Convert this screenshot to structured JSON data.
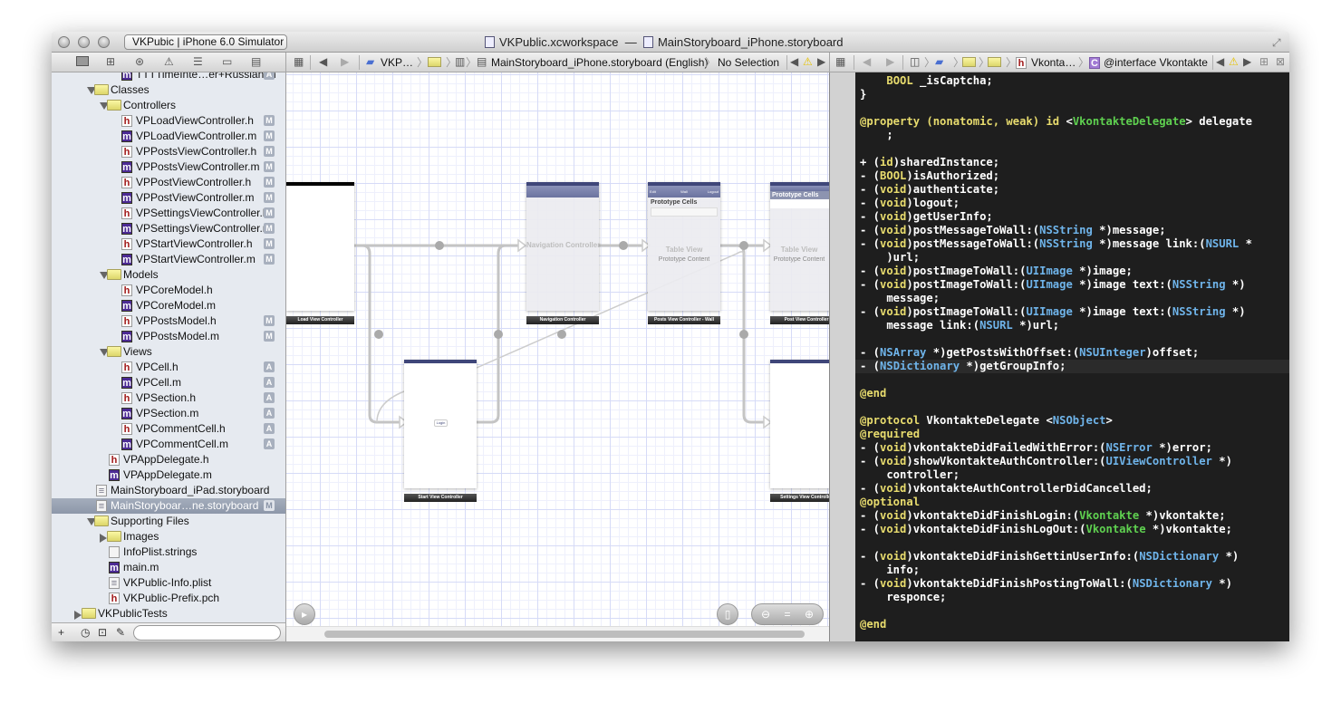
{
  "window": {
    "title_workspace": "VKPublic.xcworkspace",
    "title_sep": "—",
    "title_file": "MainStoryboard_iPhone.storyboard",
    "scheme": "VKPubic | iPhone 6.0 Simulator"
  },
  "navigator_tabs": [
    {
      "icon": "folder-icon"
    },
    {
      "icon": "hierarchy-icon"
    },
    {
      "icon": "search-icon"
    },
    {
      "icon": "warning-icon"
    },
    {
      "icon": "list-icon"
    },
    {
      "icon": "breakpoint-icon"
    },
    {
      "icon": "log-icon"
    }
  ],
  "canvas_jumpbar": {
    "project": "VKP…",
    "file": "MainStoryboard_iPhone.storyboard (English)",
    "selection": "No Selection"
  },
  "code_jumpbar": {
    "file": "Vkonta…",
    "symbol": "@interface Vkontakte"
  },
  "navigator": {
    "items": [
      {
        "label": "TTTTimeInte…er+Russian.m",
        "kind": "m",
        "level": 3,
        "badge": "A"
      },
      {
        "label": "Classes",
        "kind": "folder",
        "level": 1,
        "open": true
      },
      {
        "label": "Controllers",
        "kind": "folder",
        "level": 2,
        "open": true
      },
      {
        "label": "VPLoadViewController.h",
        "kind": "h",
        "level": 3,
        "badge": "M"
      },
      {
        "label": "VPLoadViewController.m",
        "kind": "m",
        "level": 3,
        "badge": "M"
      },
      {
        "label": "VPPostsViewController.h",
        "kind": "h",
        "level": 3,
        "badge": "M"
      },
      {
        "label": "VPPostsViewController.m",
        "kind": "m",
        "level": 3,
        "badge": "M"
      },
      {
        "label": "VPPostViewController.h",
        "kind": "h",
        "level": 3,
        "badge": "M"
      },
      {
        "label": "VPPostViewController.m",
        "kind": "m",
        "level": 3,
        "badge": "M"
      },
      {
        "label": "VPSettingsViewController.h",
        "kind": "h",
        "level": 3,
        "badge": "M"
      },
      {
        "label": "VPSettingsViewController.m",
        "kind": "m",
        "level": 3,
        "badge": "M"
      },
      {
        "label": "VPStartViewController.h",
        "kind": "h",
        "level": 3,
        "badge": "M"
      },
      {
        "label": "VPStartViewController.m",
        "kind": "m",
        "level": 3,
        "badge": "M"
      },
      {
        "label": "Models",
        "kind": "folder",
        "level": 2,
        "open": true
      },
      {
        "label": "VPCoreModel.h",
        "kind": "h",
        "level": 3
      },
      {
        "label": "VPCoreModel.m",
        "kind": "m",
        "level": 3
      },
      {
        "label": "VPPostsModel.h",
        "kind": "h",
        "level": 3,
        "badge": "M"
      },
      {
        "label": "VPPostsModel.m",
        "kind": "m",
        "level": 3,
        "badge": "M"
      },
      {
        "label": "Views",
        "kind": "folder",
        "level": 2,
        "open": true
      },
      {
        "label": "VPCell.h",
        "kind": "h",
        "level": 3,
        "badge": "A"
      },
      {
        "label": "VPCell.m",
        "kind": "m",
        "level": 3,
        "badge": "A"
      },
      {
        "label": "VPSection.h",
        "kind": "h",
        "level": 3,
        "badge": "A"
      },
      {
        "label": "VPSection.m",
        "kind": "m",
        "level": 3,
        "badge": "A"
      },
      {
        "label": "VPCommentCell.h",
        "kind": "h",
        "level": 3,
        "badge": "A"
      },
      {
        "label": "VPCommentCell.m",
        "kind": "m",
        "level": 3,
        "badge": "A"
      },
      {
        "label": "VPAppDelegate.h",
        "kind": "h",
        "level": 2
      },
      {
        "label": "VPAppDelegate.m",
        "kind": "m",
        "level": 2
      },
      {
        "label": "MainStoryboard_iPad.storyboard",
        "kind": "sb",
        "level": 1
      },
      {
        "label": "MainStoryboar…ne.storyboard",
        "kind": "sb",
        "level": 1,
        "badge": "M",
        "selected": true
      },
      {
        "label": "Supporting Files",
        "kind": "folder",
        "level": 1,
        "open": true
      },
      {
        "label": "Images",
        "kind": "folder",
        "level": 2,
        "open": false
      },
      {
        "label": "InfoPlist.strings",
        "kind": "st",
        "level": 2
      },
      {
        "label": "main.m",
        "kind": "m",
        "level": 2
      },
      {
        "label": "VKPublic-Info.plist",
        "kind": "pl",
        "level": 2
      },
      {
        "label": "VKPublic-Prefix.pch",
        "kind": "h",
        "level": 2
      },
      {
        "label": "VKPublicTests",
        "kind": "folder",
        "level": 0,
        "open": false
      }
    ]
  },
  "storyboard": {
    "scenes": {
      "load": "Load View Controller",
      "nav": "Navigation Controller",
      "posts": "Posts View Controller - Wall",
      "post": "Post View Controller",
      "start": "Start View Controller",
      "settings": "Settings View Controller"
    },
    "nav_center": "Navigation Controller",
    "table_view": "Table View",
    "prototype_content": "Prototype Content",
    "prototype_cells": "Prototype Cells",
    "wall_title": "Wall",
    "wall_left": "Edit",
    "wall_right": "Logout",
    "login_button": "Login"
  },
  "code_lines": [
    [
      [
        "    ",
        "p"
      ],
      [
        "BOOL",
        "k"
      ],
      [
        " _isCaptcha;",
        "p"
      ]
    ],
    [
      [
        "}",
        "p"
      ]
    ],
    [],
    [
      [
        "@property (nonatomic, weak) id",
        "k"
      ],
      [
        " <",
        "p"
      ],
      [
        "VkontakteDelegate",
        "g"
      ],
      [
        "> delegate",
        "p"
      ]
    ],
    [
      [
        "    ;",
        "p"
      ]
    ],
    [],
    [
      [
        "+ (",
        "p"
      ],
      [
        "id",
        "k"
      ],
      [
        ")sharedInstance;",
        "p"
      ]
    ],
    [
      [
        "- (",
        "p"
      ],
      [
        "BOOL",
        "k"
      ],
      [
        ")isAuthorized;",
        "p"
      ]
    ],
    [
      [
        "- (",
        "p"
      ],
      [
        "void",
        "k"
      ],
      [
        ")authenticate;",
        "p"
      ]
    ],
    [
      [
        "- (",
        "p"
      ],
      [
        "void",
        "k"
      ],
      [
        ")logout;",
        "p"
      ]
    ],
    [
      [
        "- (",
        "p"
      ],
      [
        "void",
        "k"
      ],
      [
        ")getUserInfo;",
        "p"
      ]
    ],
    [
      [
        "- (",
        "p"
      ],
      [
        "void",
        "k"
      ],
      [
        ")postMessageToWall:(",
        "p"
      ],
      [
        "NSString",
        "c"
      ],
      [
        " *)message;",
        "p"
      ]
    ],
    [
      [
        "- (",
        "p"
      ],
      [
        "void",
        "k"
      ],
      [
        ")postMessageToWall:(",
        "p"
      ],
      [
        "NSString",
        "c"
      ],
      [
        " *)message link:(",
        "p"
      ],
      [
        "NSURL",
        "c"
      ],
      [
        " *",
        "p"
      ]
    ],
    [
      [
        "    )url;",
        "p"
      ]
    ],
    [
      [
        "- (",
        "p"
      ],
      [
        "void",
        "k"
      ],
      [
        ")postImageToWall:(",
        "p"
      ],
      [
        "UIImage",
        "c"
      ],
      [
        " *)image;",
        "p"
      ]
    ],
    [
      [
        "- (",
        "p"
      ],
      [
        "void",
        "k"
      ],
      [
        ")postImageToWall:(",
        "p"
      ],
      [
        "UIImage",
        "c"
      ],
      [
        " *)image text:(",
        "p"
      ],
      [
        "NSString",
        "c"
      ],
      [
        " *)",
        "p"
      ]
    ],
    [
      [
        "    message;",
        "p"
      ]
    ],
    [
      [
        "- (",
        "p"
      ],
      [
        "void",
        "k"
      ],
      [
        ")postImageToWall:(",
        "p"
      ],
      [
        "UIImage",
        "c"
      ],
      [
        " *)image text:(",
        "p"
      ],
      [
        "NSString",
        "c"
      ],
      [
        " *)",
        "p"
      ]
    ],
    [
      [
        "    message link:(",
        "p"
      ],
      [
        "NSURL",
        "c"
      ],
      [
        " *)url;",
        "p"
      ]
    ],
    [],
    [
      [
        "- (",
        "p"
      ],
      [
        "NSArray",
        "c"
      ],
      [
        " *)getPostsWithOffset:(",
        "p"
      ],
      [
        "NSUInteger",
        "c"
      ],
      [
        ")offset;",
        "p"
      ]
    ],
    [
      [
        "- (",
        "p"
      ],
      [
        "NSDictionary",
        "c"
      ],
      [
        " *)getGroupInfo;",
        "p"
      ]
    ],
    [],
    [
      [
        "@end",
        "k"
      ]
    ],
    [],
    [
      [
        "@protocol",
        "k"
      ],
      [
        " VkontakteDelegate <",
        "p"
      ],
      [
        "NSObject",
        "c"
      ],
      [
        ">",
        "p"
      ]
    ],
    [
      [
        "@required",
        "k"
      ]
    ],
    [
      [
        "- (",
        "p"
      ],
      [
        "void",
        "k"
      ],
      [
        ")vkontakteDidFailedWithError:(",
        "p"
      ],
      [
        "NSError",
        "c"
      ],
      [
        " *)error;",
        "p"
      ]
    ],
    [
      [
        "- (",
        "p"
      ],
      [
        "void",
        "k"
      ],
      [
        ")showVkontakteAuthController:(",
        "p"
      ],
      [
        "UIViewController",
        "c"
      ],
      [
        " *)",
        "p"
      ]
    ],
    [
      [
        "    controller;",
        "p"
      ]
    ],
    [
      [
        "- (",
        "p"
      ],
      [
        "void",
        "k"
      ],
      [
        ")vkontakteAuthControllerDidCancelled;",
        "p"
      ]
    ],
    [
      [
        "@optional",
        "k"
      ]
    ],
    [
      [
        "- (",
        "p"
      ],
      [
        "void",
        "k"
      ],
      [
        ")vkontakteDidFinishLogin:(",
        "p"
      ],
      [
        "Vkontakte",
        "g"
      ],
      [
        " *)vkontakte;",
        "p"
      ]
    ],
    [
      [
        "- (",
        "p"
      ],
      [
        "void",
        "k"
      ],
      [
        ")vkontakteDidFinishLogOut:(",
        "p"
      ],
      [
        "Vkontakte",
        "g"
      ],
      [
        " *)vkontakte;",
        "p"
      ]
    ],
    [],
    [
      [
        "- (",
        "p"
      ],
      [
        "void",
        "k"
      ],
      [
        ")vkontakteDidFinishGettinUserInfo:(",
        "p"
      ],
      [
        "NSDictionary",
        "c"
      ],
      [
        " *)",
        "p"
      ]
    ],
    [
      [
        "    info;",
        "p"
      ]
    ],
    [
      [
        "- (",
        "p"
      ],
      [
        "void",
        "k"
      ],
      [
        ")vkontakteDidFinishPostingToWall:(",
        "p"
      ],
      [
        "NSDictionary",
        "c"
      ],
      [
        " *)",
        "p"
      ]
    ],
    [
      [
        "    responce;",
        "p"
      ]
    ],
    [],
    [
      [
        "@end",
        "k"
      ]
    ]
  ],
  "highlighted_line": 22
}
